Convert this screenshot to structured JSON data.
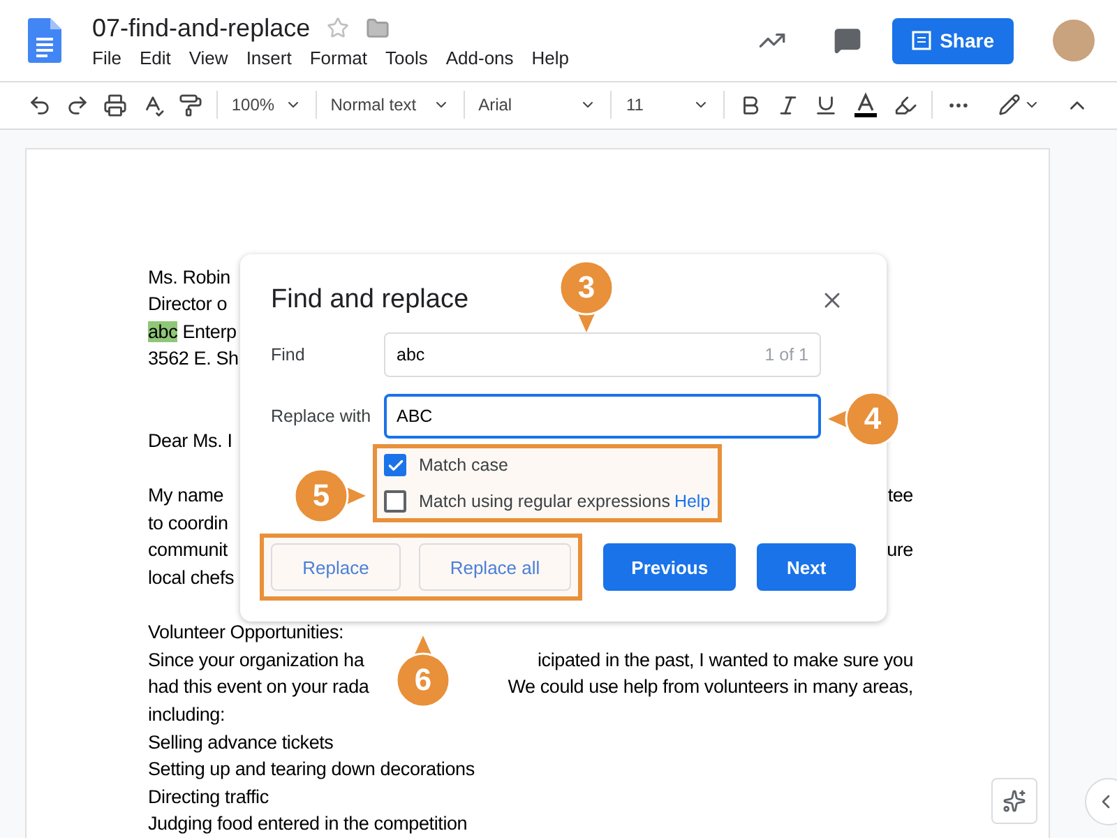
{
  "document": {
    "title": "07-find-and-replace",
    "starred": false
  },
  "menu": [
    "File",
    "Edit",
    "View",
    "Insert",
    "Format",
    "Tools",
    "Add-ons",
    "Help"
  ],
  "share_button": "Share",
  "toolbar": {
    "zoom": "100%",
    "style": "Normal text",
    "font": "Arial",
    "size": "11"
  },
  "doc_lines": [
    {
      "kind": "text",
      "segments": [
        {
          "text": "Ms. Robin",
          "highlighted": false
        }
      ]
    },
    {
      "kind": "text",
      "segments": [
        {
          "text": "Director o",
          "highlighted": false
        }
      ]
    },
    {
      "kind": "text",
      "segments": [
        {
          "text": "abc",
          "highlighted": true
        },
        {
          "text": " Enterp",
          "highlighted": false
        }
      ]
    },
    {
      "kind": "text",
      "segments": [
        {
          "text": "3562 E. Sh",
          "highlighted": false
        }
      ]
    },
    {
      "kind": "blank"
    },
    {
      "kind": "blank"
    },
    {
      "kind": "text",
      "segments": [
        {
          "text": "Dear Ms. I",
          "highlighted": false
        }
      ]
    },
    {
      "kind": "blank"
    },
    {
      "kind": "text",
      "segments": [
        {
          "text": "My name",
          "highlighted": false
        }
      ],
      "right": "tee"
    },
    {
      "kind": "text",
      "segments": [
        {
          "text": "to coordin",
          "highlighted": false
        }
      ]
    },
    {
      "kind": "text",
      "segments": [
        {
          "text": "communit",
          "highlighted": false
        }
      ],
      "right": "ure"
    },
    {
      "kind": "text",
      "segments": [
        {
          "text": "local chefs",
          "highlighted": false
        }
      ]
    },
    {
      "kind": "blank"
    },
    {
      "kind": "text",
      "segments": [
        {
          "text": "Volunteer Opportunities:",
          "highlighted": false
        }
      ]
    },
    {
      "kind": "text",
      "segments": [
        {
          "text": "Since your organization ha",
          "highlighted": false
        }
      ],
      "right": "icipated in the past, I wanted to make sure you"
    },
    {
      "kind": "text",
      "segments": [
        {
          "text": "had this event on your rada",
          "highlighted": false
        }
      ],
      "right": "We could use help from volunteers in many areas,"
    },
    {
      "kind": "text",
      "segments": [
        {
          "text": "including:",
          "highlighted": false
        }
      ]
    },
    {
      "kind": "text",
      "segments": [
        {
          "text": "Selling advance tickets",
          "highlighted": false
        }
      ]
    },
    {
      "kind": "text",
      "segments": [
        {
          "text": "Setting up and tearing down decorations",
          "highlighted": false
        }
      ]
    },
    {
      "kind": "text",
      "segments": [
        {
          "text": "Directing traffic",
          "highlighted": false
        }
      ]
    },
    {
      "kind": "text",
      "segments": [
        {
          "text": "Judging food entered in the competition",
          "highlighted": false
        }
      ]
    }
  ],
  "dialog": {
    "title": "Find and replace",
    "find": {
      "label": "Find",
      "value": "abc",
      "count": "1 of 1",
      "focused": false
    },
    "replace": {
      "label": "Replace with",
      "value": "ABC",
      "focused": true
    },
    "options": [
      {
        "label": "Match case",
        "checked": true
      },
      {
        "label": "Match using regular expressions",
        "checked": false,
        "link": "Help"
      }
    ],
    "buttons": [
      {
        "label": "Replace",
        "kind": "secondary"
      },
      {
        "label": "Replace all",
        "kind": "secondary"
      },
      {
        "label": "Previous",
        "kind": "primary"
      },
      {
        "label": "Next",
        "kind": "primary"
      }
    ]
  },
  "callouts": [
    "3",
    "4",
    "5",
    "6"
  ]
}
